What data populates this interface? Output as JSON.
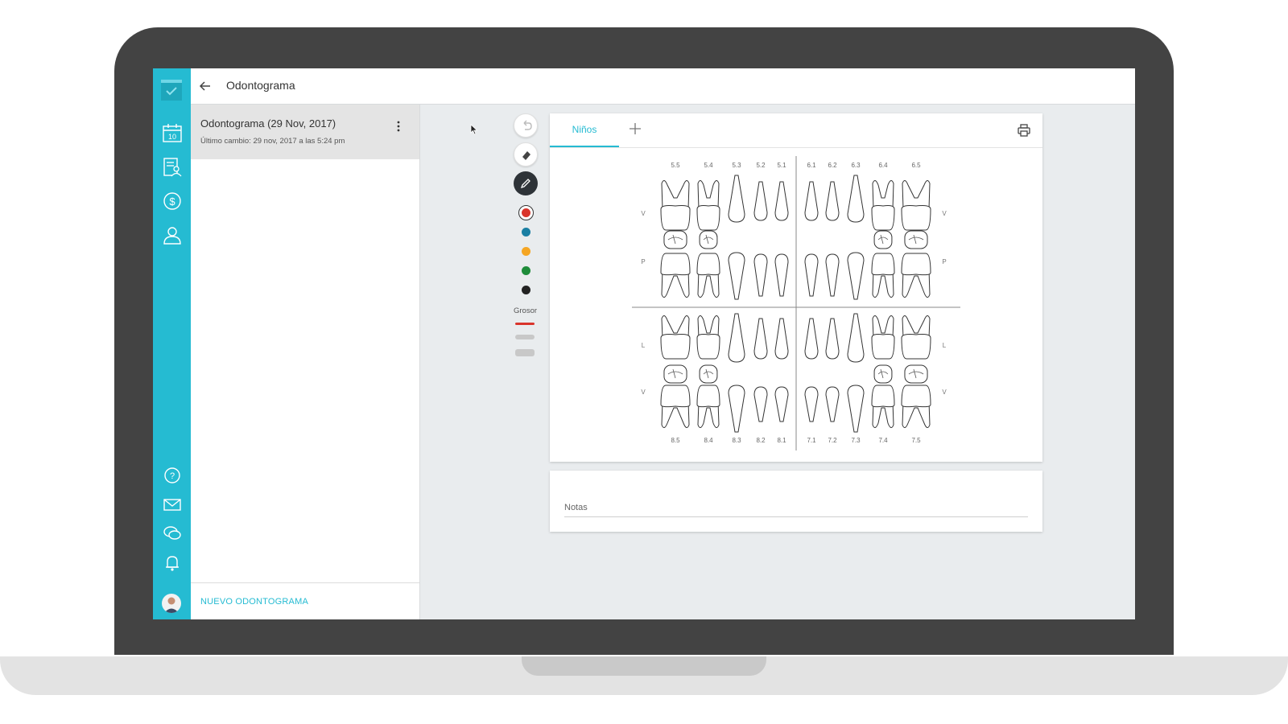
{
  "header": {
    "title": "Odontograma"
  },
  "records": [
    {
      "title": "Odontograma (29 Nov, 2017)",
      "subtitle": "Último cambio: 29 nov, 2017 a las 5:24 pm"
    }
  ],
  "new_button": "NUEVO ODONTOGRAMA",
  "calendar_day": "10",
  "tabs": [
    {
      "label": "Niños"
    }
  ],
  "toolbar": {
    "colors": [
      "#d9342b",
      "#1a7fa3",
      "#f5a623",
      "#1e8c3a",
      "#222222"
    ],
    "selected_color": "#d9342b",
    "thickness_label": "Grosor",
    "selected_thickness": 1
  },
  "odontogram": {
    "upper_right": [
      "5.5",
      "5.4",
      "5.3",
      "5.2",
      "5.1"
    ],
    "upper_left": [
      "6.1",
      "6.2",
      "6.3",
      "6.4",
      "6.5"
    ],
    "lower_right": [
      "8.5",
      "8.4",
      "8.3",
      "8.2",
      "8.1"
    ],
    "lower_left": [
      "7.1",
      "7.2",
      "7.3",
      "7.4",
      "7.5"
    ],
    "side_labels": {
      "upper_outer": "V",
      "upper_inner": "P",
      "lower_inner": "L",
      "lower_outer": "V"
    }
  },
  "notes": {
    "label": "Notas"
  },
  "accent_color": "#25bbd2"
}
